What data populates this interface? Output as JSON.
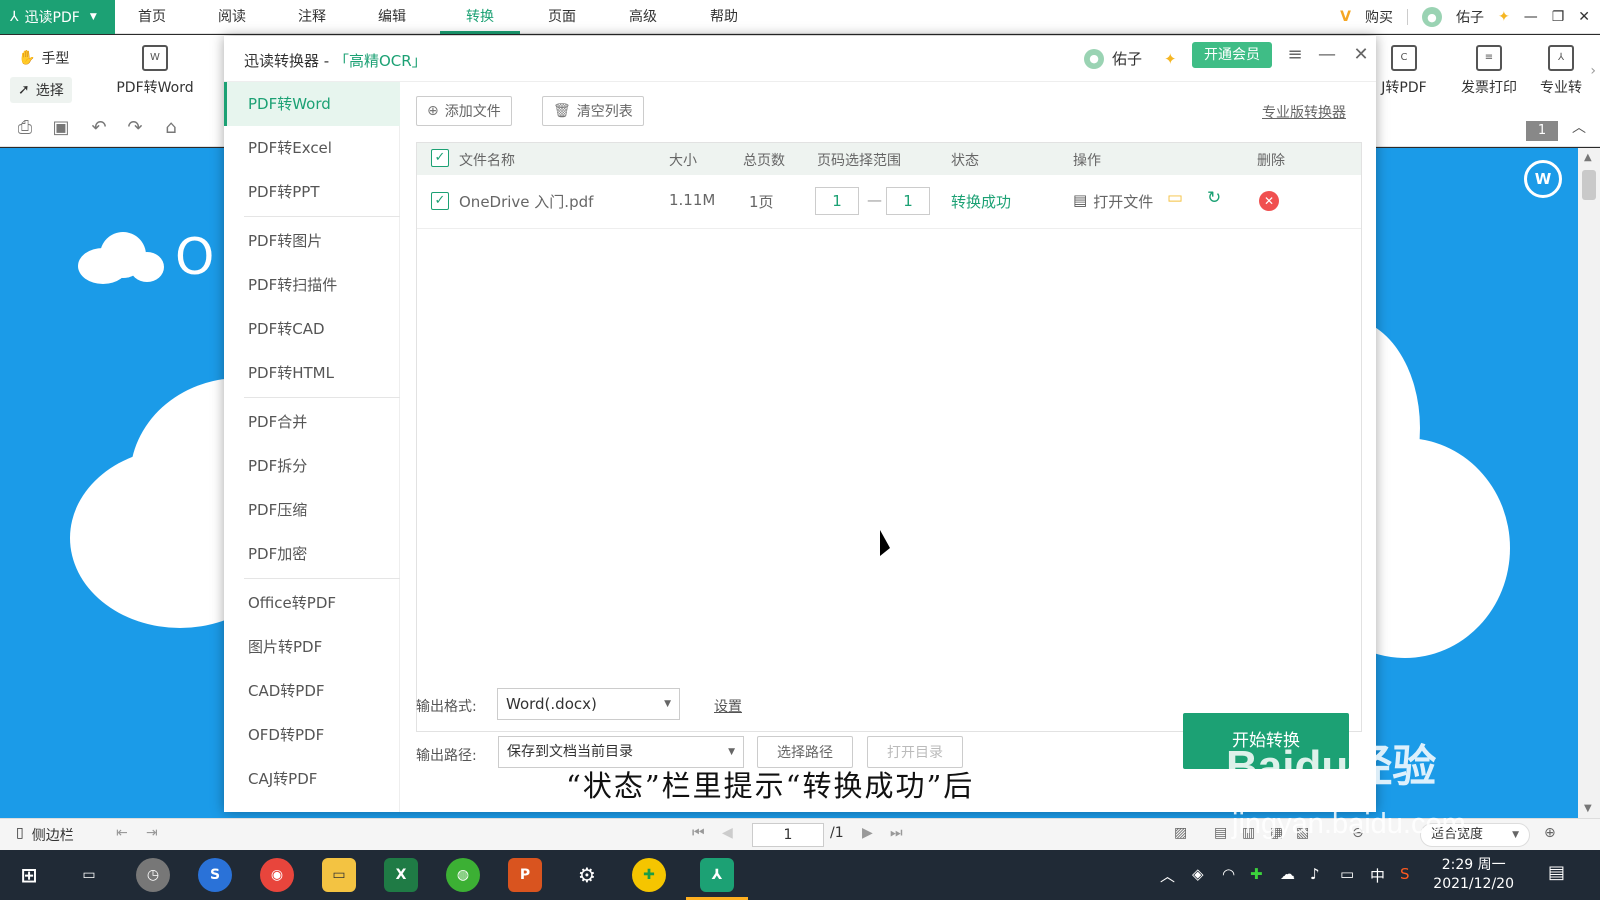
{
  "app": {
    "name": "迅读PDF",
    "menu": [
      "首页",
      "阅读",
      "注释",
      "编辑",
      "转换",
      "页面",
      "高级",
      "帮助"
    ],
    "active_menu": "转换",
    "buy": "购买",
    "user": "佑子"
  },
  "toolbar": {
    "hand": "手型",
    "select": "选择",
    "pdf_to_word": "PDF转Word",
    "caj_to_pdf": "J转PDF",
    "invoice_print": "发票打印",
    "pro": "专业转",
    "page_badge": "1"
  },
  "dialog": {
    "title": "迅读转换器 - ",
    "ocr": "「高精OCR」",
    "user": "佑子",
    "vip_button": "开通会员",
    "sidebar": [
      "PDF转Word",
      "PDF转Excel",
      "PDF转PPT",
      "PDF转图片",
      "PDF转扫描件",
      "PDF转CAD",
      "PDF转HTML",
      "PDF合并",
      "PDF拆分",
      "PDF压缩",
      "PDF加密",
      "Office转PDF",
      "图片转PDF",
      "CAD转PDF",
      "OFD转PDF",
      "CAJ转PDF"
    ],
    "add_file": "添加文件",
    "clear_list": "清空列表",
    "pro_link": "专业版转换器",
    "columns": {
      "name": "文件名称",
      "size": "大小",
      "pages": "总页数",
      "range": "页码选择范围",
      "status": "状态",
      "action": "操作",
      "delete": "删除"
    },
    "rows": [
      {
        "name": "OneDrive 入门.pdf",
        "size": "1.11M",
        "pages": "1页",
        "from": "1",
        "to": "1",
        "status": "转换成功",
        "open": "打开文件"
      }
    ],
    "range_dash": "—",
    "output_format_label": "输出格式:",
    "output_format": "Word(.docx)",
    "settings": "设置",
    "output_path_label": "输出路径:",
    "output_path": "保存到文档当前目录",
    "choose_path": "选择路径",
    "open_dir": "打开目录",
    "start": "开始转换"
  },
  "statusbar": {
    "sidebar": "侧边栏",
    "page": "1",
    "total": "/1",
    "zoom": "适合宽度"
  },
  "taskbar": {
    "time": "2:29 周一",
    "date": "2021/12/20",
    "ime": "中"
  },
  "caption": "“状态”栏里提示“转换成功”后",
  "watermark": "Baidu经验",
  "watermark_url": "jingyan.baidu.com",
  "colors": {
    "accent": "#1ca174",
    "doc_bg": "#1b9be8",
    "delete": "#f05050"
  }
}
